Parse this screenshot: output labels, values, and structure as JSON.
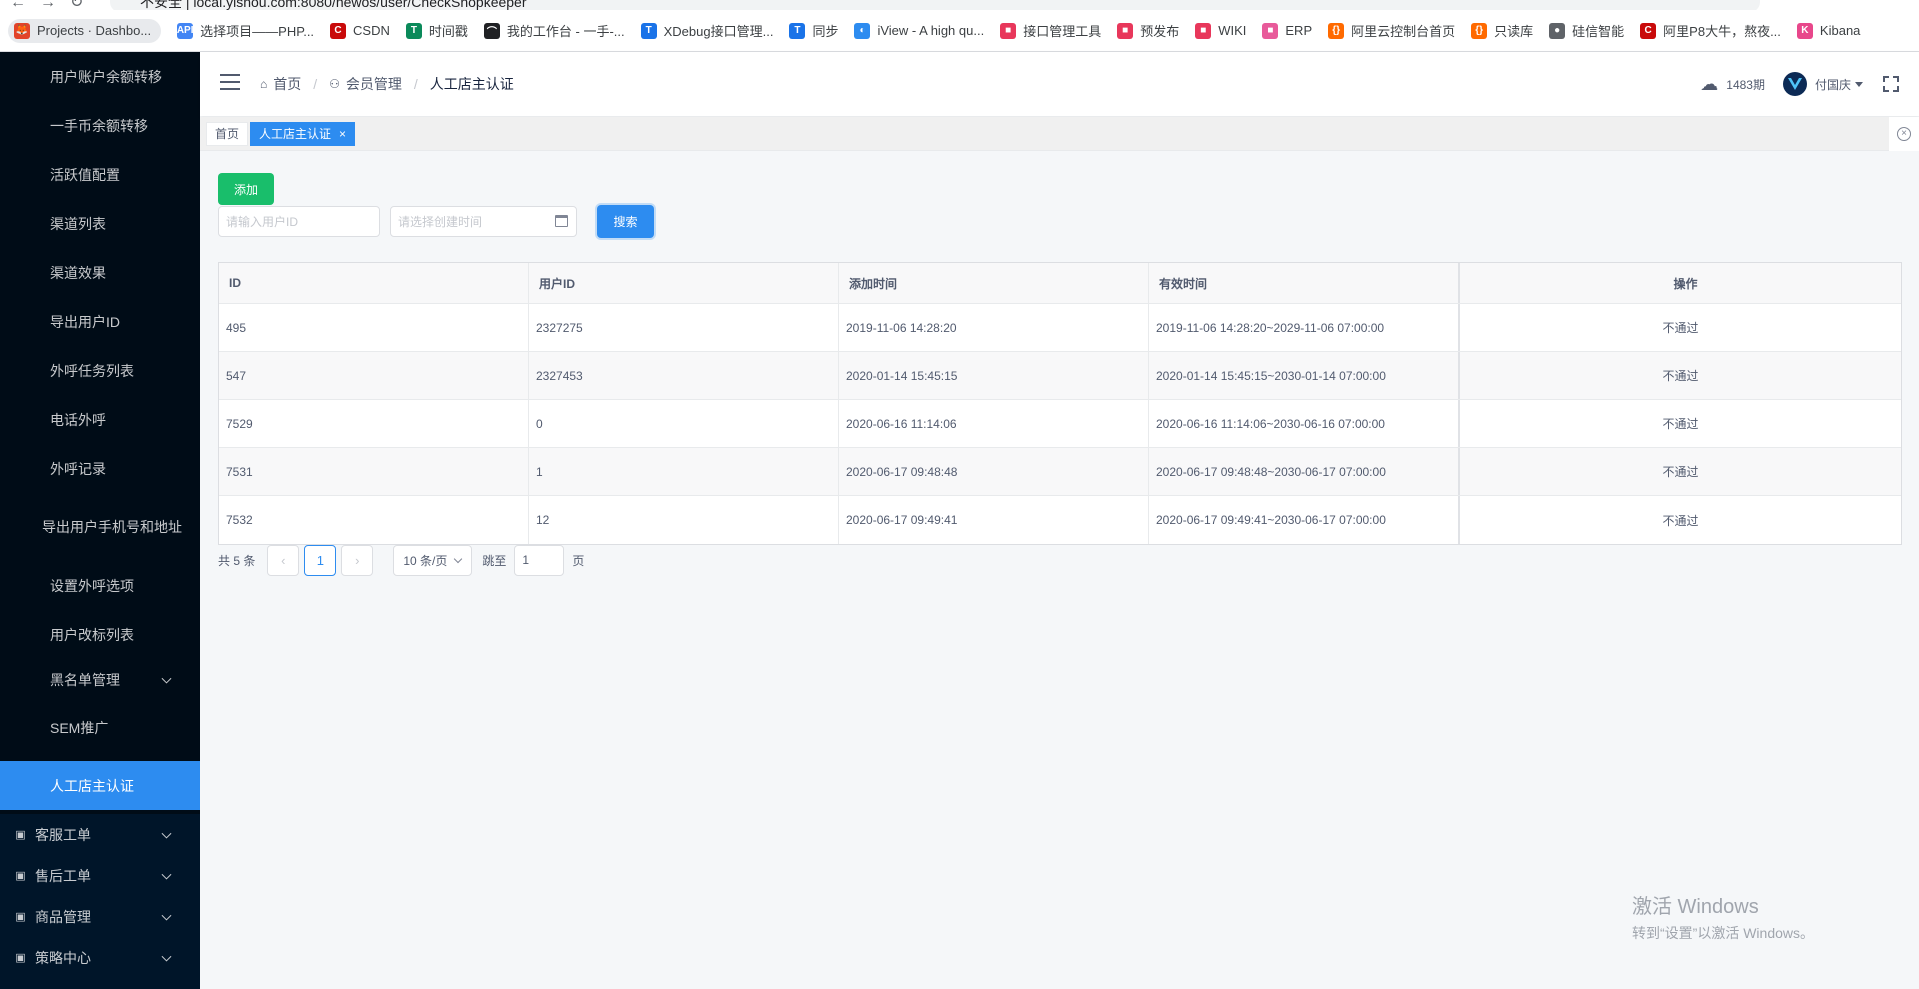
{
  "browser": {
    "address": "不安全 | local.yishou.com:8080/newos/user/CheckShopkeeper",
    "bookmarks": [
      {
        "label": "Projects · Dashbo...",
        "color": "#e24329",
        "glyph": "🦊"
      },
      {
        "label": "选择项目——PHP...",
        "color": "#4285f4",
        "glyph": "API"
      },
      {
        "label": "CSDN",
        "color": "#c90a0a",
        "glyph": "C"
      },
      {
        "label": "时间戳",
        "color": "#0b8a5a",
        "glyph": "T"
      },
      {
        "label": "我的工作台 - 一手-...",
        "color": "#202124",
        "glyph": "⌒"
      },
      {
        "label": "XDebug接口管理...",
        "color": "#1a73e8",
        "glyph": "T"
      },
      {
        "label": "同步",
        "color": "#1a73e8",
        "glyph": "T"
      },
      {
        "label": "iView - A high qu...",
        "color": "#2d8cf0",
        "glyph": "◐"
      },
      {
        "label": "接口管理工具",
        "color": "#e8375b",
        "glyph": "■"
      },
      {
        "label": "预发布",
        "color": "#e8375b",
        "glyph": "■"
      },
      {
        "label": "WIKI",
        "color": "#e8375b",
        "glyph": "■"
      },
      {
        "label": "ERP",
        "color": "#e85a9a",
        "glyph": "■"
      },
      {
        "label": "阿里云控制台首页",
        "color": "#ff6a00",
        "glyph": "{}"
      },
      {
        "label": "只读库",
        "color": "#ff6a00",
        "glyph": "{}"
      },
      {
        "label": "硅信智能",
        "color": "#5f6368",
        "glyph": "●"
      },
      {
        "label": "阿里P8大牛，熬夜...",
        "color": "#c90a0a",
        "glyph": "C"
      },
      {
        "label": "Kibana",
        "color": "#e8478b",
        "glyph": "K"
      }
    ]
  },
  "sidebar": {
    "sub_items": [
      {
        "label": "用户账户余额转移",
        "active": false
      },
      {
        "label": "一手币余额转移",
        "active": false
      },
      {
        "label": "活跃值配置",
        "active": false
      },
      {
        "label": "渠道列表",
        "active": false
      },
      {
        "label": "渠道效果",
        "active": false
      },
      {
        "label": "导出用户ID",
        "active": false
      },
      {
        "label": "外呼任务列表",
        "active": false
      },
      {
        "label": "电话外呼",
        "active": false
      },
      {
        "label": "外呼记录",
        "active": false
      },
      {
        "label": "导出用户手机号和地址",
        "active": false
      },
      {
        "label": "设置外呼选项",
        "active": false
      },
      {
        "label": "用户改标列表",
        "active": false
      },
      {
        "label": "黑名单管理",
        "active": false
      },
      {
        "label": "SEM推广",
        "active": false
      },
      {
        "label": "人工店主认证",
        "active": true
      }
    ],
    "top_items": [
      {
        "label": "客服工单"
      },
      {
        "label": "售后工单"
      },
      {
        "label": "商品管理"
      },
      {
        "label": "策略中心"
      }
    ]
  },
  "header": {
    "breadcrumb": [
      "首页",
      "会员管理",
      "人工店主认证"
    ],
    "period": "1483期",
    "username": "付国庆"
  },
  "tags": {
    "home": "首页",
    "current": "人工店主认证",
    "close_glyph": "×"
  },
  "toolbar": {
    "add_label": "添加",
    "user_id_placeholder": "请输入用户ID",
    "date_placeholder": "请选择创建时间",
    "search_label": "搜索"
  },
  "table": {
    "columns": [
      "ID",
      "用户ID",
      "添加时间",
      "有效时间",
      "操作"
    ],
    "rows": [
      [
        "495",
        "2327275",
        "2019-11-06 14:28:20",
        "2019-11-06 14:28:20~2029-11-06 07:00:00",
        "不通过"
      ],
      [
        "547",
        "2327453",
        "2020-01-14 15:45:15",
        "2020-01-14 15:45:15~2030-01-14 07:00:00",
        "不通过"
      ],
      [
        "7529",
        "0",
        "2020-06-16 11:14:06",
        "2020-06-16 11:14:06~2030-06-16 07:00:00",
        "不通过"
      ],
      [
        "7531",
        "1",
        "2020-06-17 09:48:48",
        "2020-06-17 09:48:48~2030-06-17 07:00:00",
        "不通过"
      ],
      [
        "7532",
        "12",
        "2020-06-17 09:49:41",
        "2020-06-17 09:49:41~2030-06-17 07:00:00",
        "不通过"
      ]
    ]
  },
  "pager": {
    "total": "共 5 条",
    "prev": "‹",
    "current": "1",
    "next": "›",
    "page_size": "10 条/页",
    "jump_label": "跳至",
    "jump_value": "1",
    "page_unit": "页"
  },
  "watermark": {
    "line1": "激活 Windows",
    "line2": "转到“设置”以激活 Windows。"
  }
}
